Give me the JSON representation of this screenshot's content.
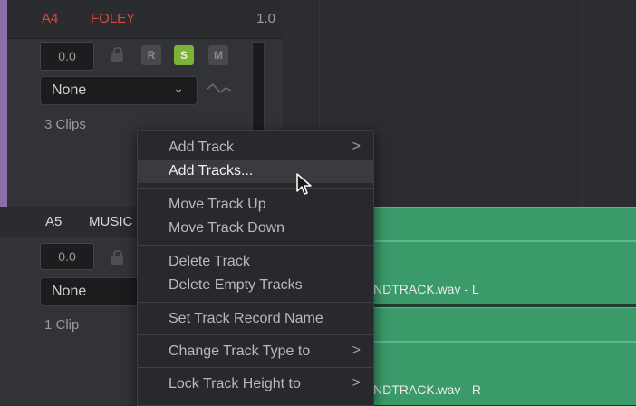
{
  "colors": {
    "track_a4_name": "#d64b3f",
    "solo_active": "#7bb33a",
    "clip_green": "#3a9a6a",
    "track_a4_stripe": "#8a6fa8"
  },
  "track_a4": {
    "id": "A4",
    "name": "FOLEY",
    "level": "1.0",
    "volume": "0.0",
    "buttons": {
      "record": "R",
      "solo": "S",
      "mute": "M"
    },
    "preset": "None",
    "clip_count": "3 Clips"
  },
  "track_a5": {
    "id": "A5",
    "name": "MUSIC",
    "volume": "0.0",
    "preset": "None",
    "clip_count": "1 Clip"
  },
  "clips": {
    "left": "NDTRACK.wav - L",
    "right": "NDTRACK.wav - R"
  },
  "context_menu": {
    "items": [
      {
        "label": "Add Track",
        "submenu": ">"
      },
      {
        "label": "Add Tracks...",
        "highlighted": true
      },
      {
        "label": "Move Track Up"
      },
      {
        "label": "Move Track Down"
      },
      {
        "label": "Delete Track"
      },
      {
        "label": "Delete Empty Tracks"
      },
      {
        "label": "Set Track Record Name"
      },
      {
        "label": "Change Track Type to",
        "submenu": ">"
      },
      {
        "label": "Lock Track Height to",
        "submenu": ">"
      }
    ]
  },
  "icons": [
    "lock-icon",
    "chevron-down-icon",
    "automation-curve-icon",
    "submenu-arrow-icon",
    "mouse-pointer-icon"
  ]
}
